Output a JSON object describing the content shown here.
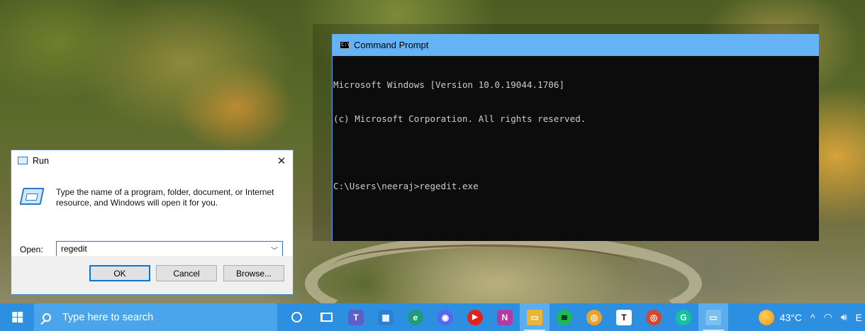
{
  "cmd": {
    "title": "Command Prompt",
    "lines": [
      "Microsoft Windows [Version 10.0.19044.1706]",
      "(c) Microsoft Corporation. All rights reserved.",
      "C:\\Users\\neeraj>regedit.exe"
    ]
  },
  "run": {
    "title": "Run",
    "close_glyph": "✕",
    "description": "Type the name of a program, folder, document, or Internet resource, and Windows will open it for you.",
    "open_label": "Open:",
    "open_value": "regedit",
    "ok_label": "OK",
    "cancel_label": "Cancel",
    "browse_label": "Browse..."
  },
  "taskbar": {
    "search_placeholder": "Type here to search",
    "apps": [
      {
        "icon": "teams-icon",
        "glyph": "T",
        "color": "#5b5fc7"
      },
      {
        "icon": "microsoft-store-icon",
        "glyph": "▦",
        "color": "#2b7fd4"
      },
      {
        "icon": "edge-icon",
        "glyph": "e",
        "color": "#1f9b7b"
      },
      {
        "icon": "discord-icon",
        "glyph": "◉",
        "color": "#5865f2"
      },
      {
        "icon": "youtube-music-icon",
        "glyph": "▶",
        "color": "#e62117"
      },
      {
        "icon": "onenote-icon",
        "glyph": "N",
        "color": "#b23aa0"
      },
      {
        "icon": "file-explorer-icon",
        "glyph": "▭",
        "color": "#e8b43a"
      },
      {
        "icon": "spotify-icon",
        "glyph": "≋",
        "color": "#1db954"
      },
      {
        "icon": "chrome-icon",
        "glyph": "◎",
        "color": "#e9a12a"
      },
      {
        "icon": "typora-icon",
        "glyph": "T",
        "color": "#ffffff"
      },
      {
        "icon": "chrome-profile-icon",
        "glyph": "◎",
        "color": "#d9452f"
      },
      {
        "icon": "grammarly-icon",
        "glyph": "G",
        "color": "#15c39a"
      },
      {
        "icon": "remote-desktop-icon",
        "glyph": "▭",
        "color": "#7cc0f2"
      }
    ],
    "temperature": "43°C",
    "tray_chevron": "^",
    "language": "E"
  }
}
